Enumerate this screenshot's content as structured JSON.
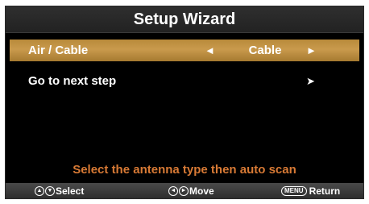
{
  "title": "Setup Wizard",
  "menu": {
    "items": [
      {
        "label": "Air / Cable",
        "value": "Cable",
        "left_arrow": "◄",
        "right_arrow": "►"
      },
      {
        "label": "Go to next step",
        "right_arrow": "➤"
      }
    ]
  },
  "hint": "Select the antenna type then auto scan",
  "footer": {
    "select_label": "Select",
    "select_icons": [
      "▲",
      "▼"
    ],
    "move_label": "Move",
    "move_icons": [
      "◄",
      "►"
    ],
    "menu_key": "MENU",
    "return_label": "Return"
  },
  "colors": {
    "selected_row": "#c99a4d",
    "hint_text": "#d87a35",
    "background": "#000000"
  }
}
